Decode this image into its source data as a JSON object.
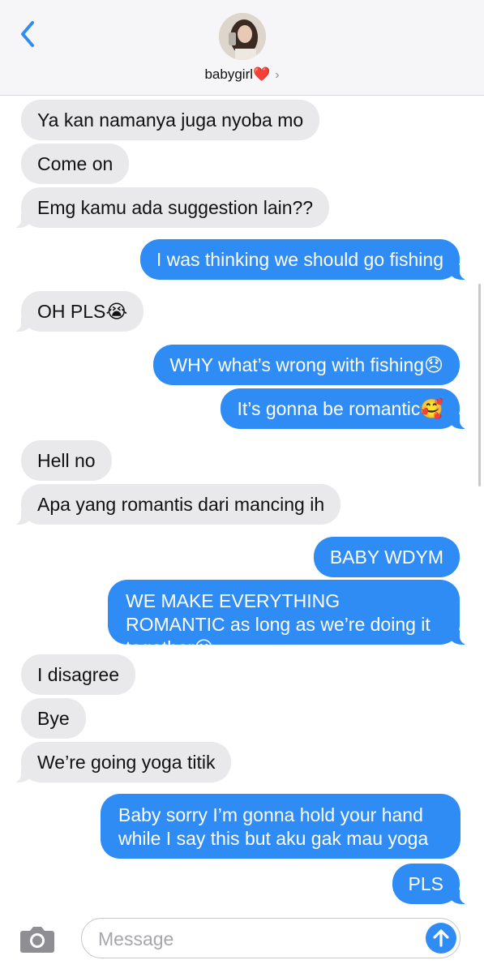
{
  "header": {
    "contact_name": "babygirl",
    "contact_emoji": "❤️",
    "chevron": "›"
  },
  "messages": [
    {
      "dir": "in",
      "text": "Ya kan namanya juga nyoba mo"
    },
    {
      "dir": "in",
      "text": "Come on"
    },
    {
      "dir": "in",
      "text": "Emg kamu ada suggestion lain??"
    },
    {
      "dir": "out",
      "text": "I was thinking we should go fishing"
    },
    {
      "dir": "in",
      "text": "OH PLS😭"
    },
    {
      "dir": "out",
      "text": "WHY what’s wrong with fishing😞"
    },
    {
      "dir": "out",
      "text": "It’s gonna be romantic🥰"
    },
    {
      "dir": "in",
      "text": "Hell no"
    },
    {
      "dir": "in",
      "text": "Apa yang romantis dari mancing ih"
    },
    {
      "dir": "out",
      "text": "BABY WDYM"
    },
    {
      "dir": "out",
      "text": "WE MAKE EVERYTHING ROMANTIC as long as we’re doing it together😗"
    },
    {
      "dir": "in",
      "text": "I disagree"
    },
    {
      "dir": "in",
      "text": "Bye"
    },
    {
      "dir": "in",
      "text": "We’re going yoga titik"
    },
    {
      "dir": "out",
      "text": "Baby sorry I’m gonna hold your hand while I say this but aku gak mau yoga"
    },
    {
      "dir": "out",
      "text": "PLS"
    }
  ],
  "composer": {
    "placeholder": "Message"
  },
  "icons": {
    "back": "chevron-left-icon",
    "camera": "camera-icon",
    "send": "arrow-up-icon"
  },
  "colors": {
    "accent": "#2f8cf5",
    "incoming_bubble": "#e9e9eb",
    "header_bg": "#f6f6f8"
  }
}
